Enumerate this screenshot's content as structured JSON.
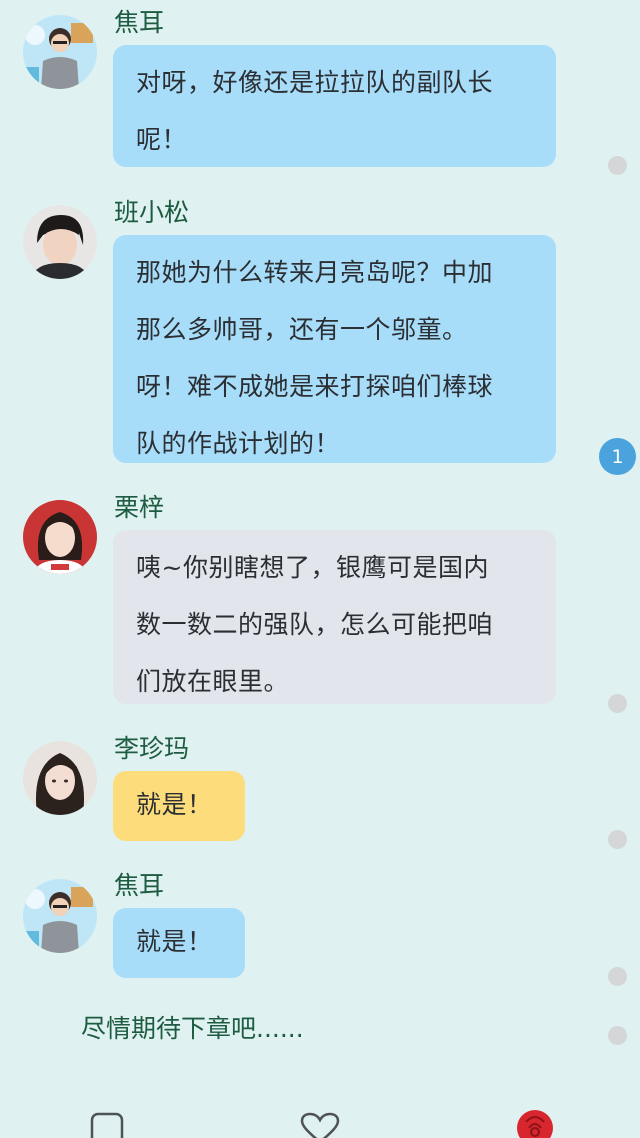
{
  "messages": [
    {
      "name": "焦耳",
      "lines": [
        "对呀，好像还是拉拉队的副队长",
        "呢！"
      ],
      "bubble_color": "#a8ddfa"
    },
    {
      "name": "班小松",
      "lines": [
        "那她为什么转来月亮岛呢？中加",
        "那么多帅哥，还有一个邬童。",
        "呀！难不成她是来打探咱们棒球",
        "队的作战计划的！"
      ],
      "bubble_color": "#a8ddfa"
    },
    {
      "name": "栗梓",
      "lines": [
        "咦~你别瞎想了，银鹰可是国内",
        "数一数二的强队，怎么可能把咱",
        "们放在眼里。"
      ],
      "bubble_color": "#e2e5ec"
    },
    {
      "name": "李珍玛",
      "lines": [
        "就是！"
      ],
      "bubble_color": "#fddd7b"
    },
    {
      "name": "焦耳",
      "lines": [
        "就是！"
      ],
      "bubble_color": "#a8ddfa"
    }
  ],
  "badge_count": "1",
  "ending_text": "尽情期待下章吧......",
  "bottom_bar": {
    "icons": [
      "comment-icon",
      "heart-icon",
      "rose-icon"
    ]
  },
  "colors": {
    "background": "#dff1f1",
    "name_text": "#1d5c40",
    "badge": "#4aa3dd"
  }
}
